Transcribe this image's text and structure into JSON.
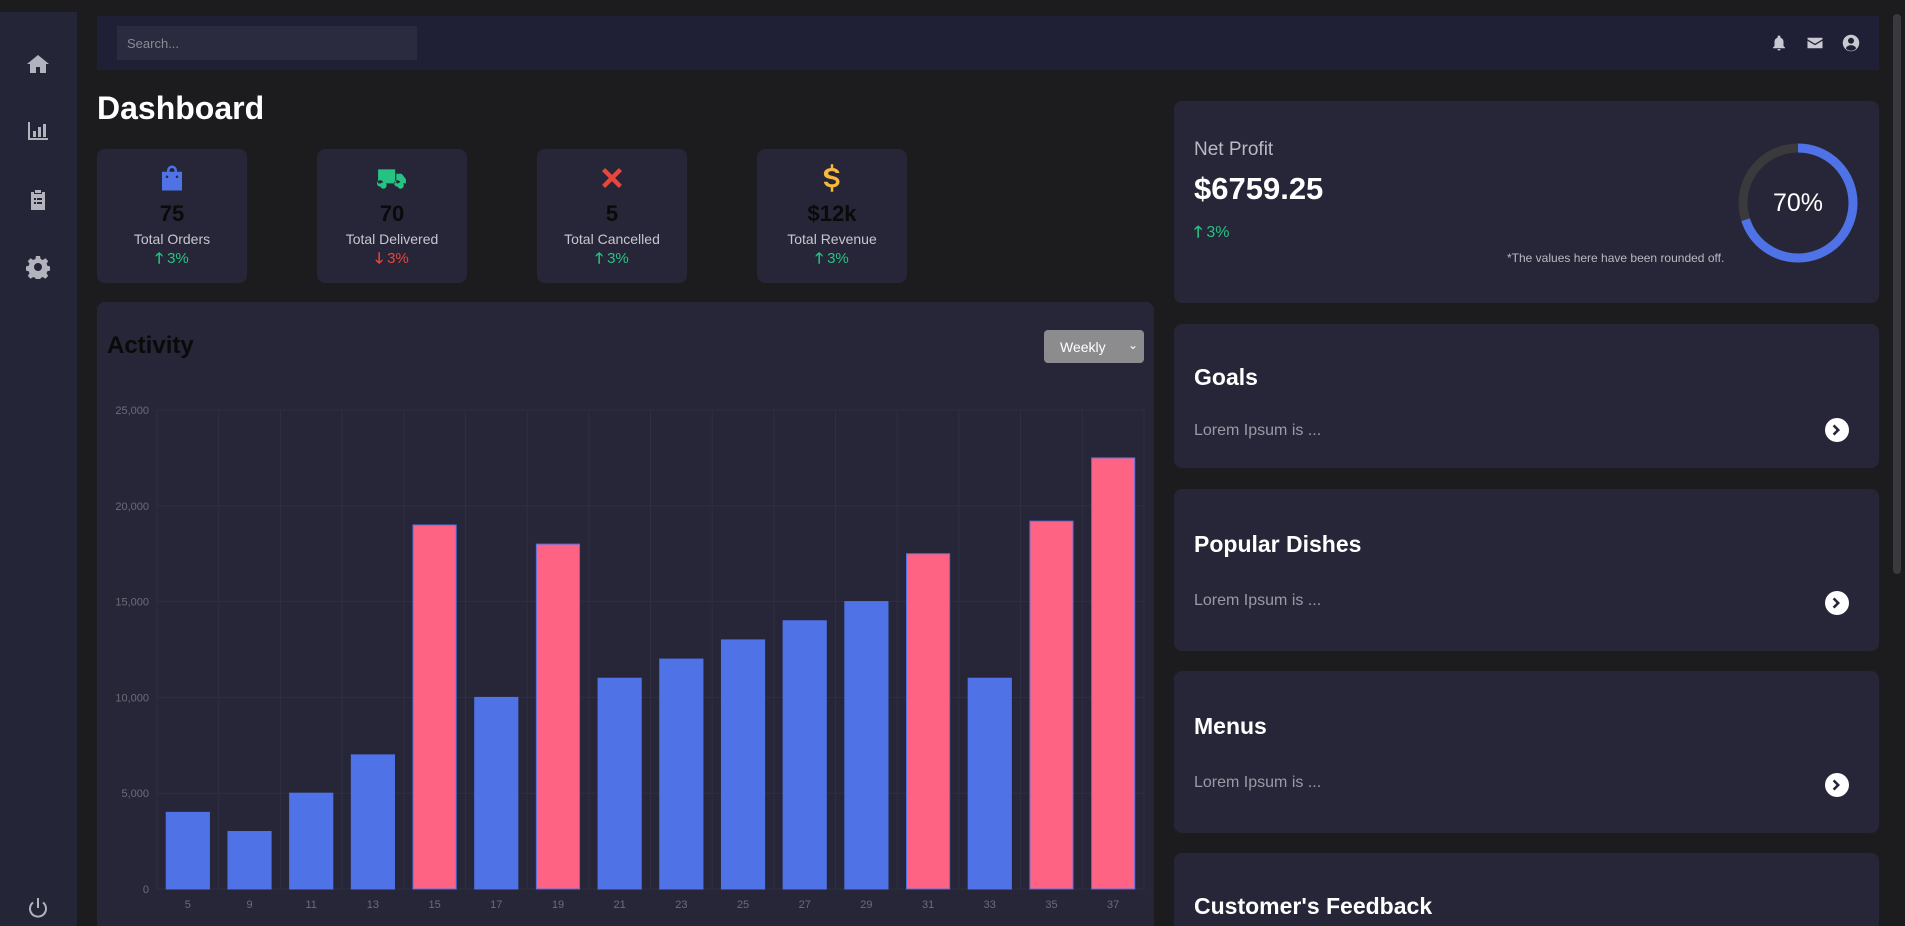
{
  "sidebar": {
    "items": [
      {
        "icon": "home-icon"
      },
      {
        "icon": "bar-chart-icon"
      },
      {
        "icon": "clipboard-icon"
      },
      {
        "icon": "gear-icon"
      },
      {
        "icon": "power-icon"
      }
    ]
  },
  "topbar": {
    "search_placeholder": "Search...",
    "icons": [
      "bell-icon",
      "envelope-icon",
      "user-circle-icon"
    ]
  },
  "page": {
    "title": "Dashboard"
  },
  "stats": [
    {
      "icon": "shopping-bag-icon",
      "color": "#4f73e6",
      "value": "75",
      "label": "Total Orders",
      "change": "3%",
      "direction": "up"
    },
    {
      "icon": "truck-icon",
      "color": "#26c281",
      "value": "70",
      "label": "Total Delivered",
      "change": "3%",
      "direction": "down"
    },
    {
      "icon": "x-mark-icon",
      "color": "#e8453c",
      "value": "5",
      "label": "Total Cancelled",
      "change": "3%",
      "direction": "up"
    },
    {
      "icon": "dollar-icon",
      "color": "#f6b93b",
      "value": "$12k",
      "label": "Total Revenue",
      "change": "3%",
      "direction": "up"
    }
  ],
  "activity": {
    "title": "Activity",
    "period": "Weekly"
  },
  "net_profit": {
    "label": "Net Profit",
    "value": "$6759.25",
    "change": "3%",
    "note": "*The values here have been rounded off.",
    "gauge_percent": 70,
    "gauge_label": "70%"
  },
  "panels": [
    {
      "title": "Goals",
      "text": "Lorem Ipsum is ..."
    },
    {
      "title": "Popular Dishes",
      "text": "Lorem Ipsum is ..."
    },
    {
      "title": "Menus",
      "text": "Lorem Ipsum is ..."
    },
    {
      "title": "Customer's Feedback",
      "text": ""
    }
  ],
  "colors": {
    "bar_blue": "#4f73e6",
    "bar_pink": "#ff6384",
    "up": "#26c281",
    "down": "#e8453c"
  },
  "chart_data": {
    "type": "bar",
    "categories": [
      "5",
      "9",
      "11",
      "13",
      "15",
      "17",
      "19",
      "21",
      "23",
      "25",
      "27",
      "29",
      "31",
      "33",
      "35",
      "37"
    ],
    "values": [
      4000,
      3000,
      5000,
      7000,
      19000,
      10000,
      18000,
      11000,
      12000,
      13000,
      14000,
      15000,
      17500,
      11000,
      19200,
      22500
    ],
    "bar_colors": [
      "blue",
      "blue",
      "blue",
      "blue",
      "pink",
      "blue",
      "pink",
      "blue",
      "blue",
      "blue",
      "blue",
      "blue",
      "pink",
      "blue",
      "pink",
      "pink"
    ],
    "y_ticks": [
      "0",
      "5,000",
      "10,000",
      "15,000",
      "20,000",
      "25,000"
    ],
    "ylim": [
      0,
      25000
    ],
    "grid": true,
    "title": "",
    "xlabel": "",
    "ylabel": ""
  }
}
